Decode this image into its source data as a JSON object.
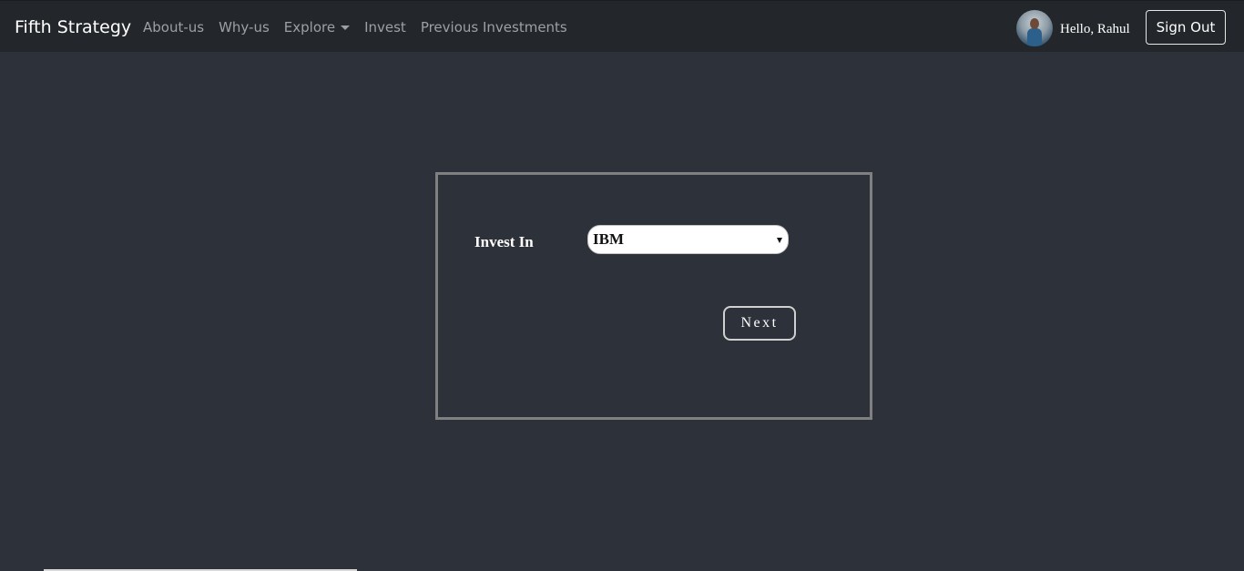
{
  "navbar": {
    "brand": "Fifth Strategy",
    "links": [
      {
        "label": "About-us"
      },
      {
        "label": "Why-us"
      },
      {
        "label": "Explore"
      },
      {
        "label": "Invest"
      },
      {
        "label": "Previous Investments"
      }
    ],
    "greeting": "Hello, Rahul",
    "signout_label": "Sign Out"
  },
  "form": {
    "invest_label": "Invest In",
    "invest_selected": "IBM",
    "next_label": "Next"
  },
  "colors": {
    "background": "#2d3139",
    "navbar": "#23272b",
    "panel_border": "#808080"
  },
  "icons": {
    "explore_caret": "caret-down-icon",
    "select_arrow": "dropdown-arrow-icon"
  }
}
